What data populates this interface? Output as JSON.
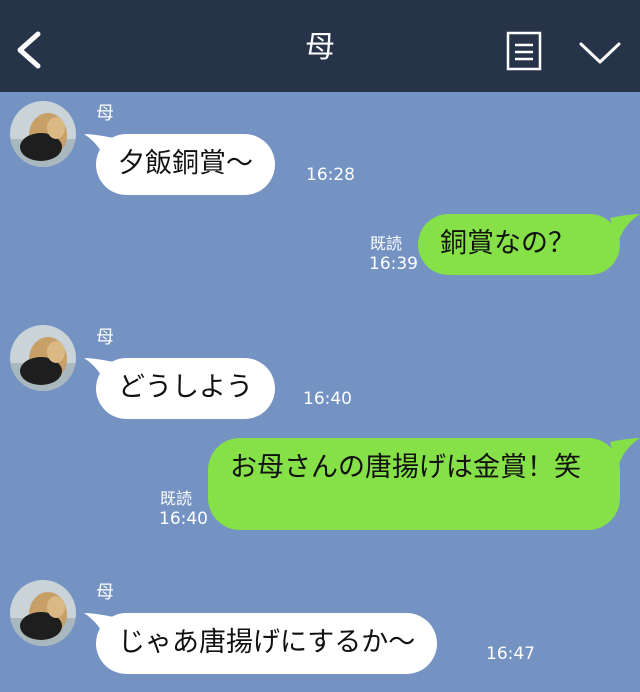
{
  "header": {
    "title": "母",
    "back_icon": "chevron-left-icon",
    "menu_icon": "document-lines-icon",
    "collapse_icon": "chevron-down-icon",
    "background": "#263349"
  },
  "chat": {
    "background": "#7493c3",
    "incoming_color": "#ffffff",
    "outgoing_color": "#86e047",
    "messages": [
      {
        "direction": "incoming",
        "sender": "母",
        "text": "夕飯銅賞〜",
        "time": "16:28"
      },
      {
        "direction": "outgoing",
        "text": "銅賞なの？",
        "read": "既読",
        "time": "16:39"
      },
      {
        "direction": "incoming",
        "sender": "母",
        "text": "どうしよう",
        "time": "16:40"
      },
      {
        "direction": "outgoing",
        "text": "お母さんの唐揚げは金賞！笑",
        "read": "既読",
        "time": "16:40"
      },
      {
        "direction": "incoming",
        "sender": "母",
        "text": "じゃあ唐揚げにするか〜",
        "time": "16:47"
      }
    ]
  }
}
